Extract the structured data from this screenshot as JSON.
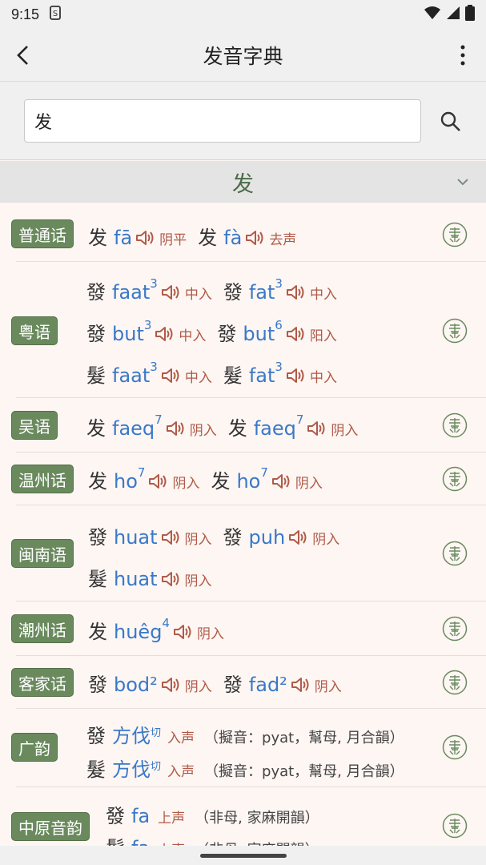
{
  "status": {
    "time": "9:15",
    "sim_icon": "sim-icon"
  },
  "app": {
    "title": "发音字典"
  },
  "search": {
    "value": "发",
    "placeholder": ""
  },
  "header": {
    "char": "发"
  },
  "rows": {
    "putonghua": {
      "label": "普通话",
      "l1": {
        "a_hz": "发",
        "a_py": "fā",
        "a_tone": "阴平",
        "b_hz": "发",
        "b_py": "fà",
        "b_tone": "去声"
      }
    },
    "yue": {
      "label": "粤语",
      "l1": {
        "a_hz": "發",
        "a_py": "faat",
        "a_n": "3",
        "a_tone": "中入",
        "b_hz": "發",
        "b_py": "fat",
        "b_n": "3",
        "b_tone": "中入"
      },
      "l2": {
        "a_hz": "發",
        "a_py": "but",
        "a_n": "3",
        "a_tone": "中入",
        "b_hz": "發",
        "b_py": "but",
        "b_n": "6",
        "b_tone": "阳入"
      },
      "l3": {
        "a_hz": "髮",
        "a_py": "faat",
        "a_n": "3",
        "a_tone": "中入",
        "b_hz": "髮",
        "b_py": "fat",
        "b_n": "3",
        "b_tone": "中入"
      }
    },
    "wu": {
      "label": "吴语",
      "l1": {
        "a_hz": "发",
        "a_py": "faeq",
        "a_n": "7",
        "a_tone": "阴入",
        "b_hz": "发",
        "b_py": "faeq",
        "b_n": "7",
        "b_tone": "阴入"
      }
    },
    "wenzhou": {
      "label": "温州话",
      "l1": {
        "a_hz": "发",
        "a_py": "ho",
        "a_n": "7",
        "a_tone": "阴入",
        "b_hz": "发",
        "b_py": "ho",
        "b_n": "7",
        "b_tone": "阴入"
      }
    },
    "minnan": {
      "label": "闽南语",
      "l1": {
        "a_hz": "發",
        "a_py": "huat",
        "a_tone": "阴入",
        "b_hz": "發",
        "b_py": "puh",
        "b_tone": "阴入"
      },
      "l2": {
        "a_hz": "髮",
        "a_py": "huat",
        "a_tone": "阴入"
      }
    },
    "chaozhou": {
      "label": "潮州话",
      "l1": {
        "a_hz": "发",
        "a_py": "huêg",
        "a_n": "4",
        "a_tone": "阴入"
      }
    },
    "hakka": {
      "label": "客家话",
      "l1": {
        "a_hz": "發",
        "a_py": "bod²",
        "a_tone": "阴入",
        "b_hz": "發",
        "b_py": "fad²",
        "b_tone": "阴入"
      }
    },
    "guangyun": {
      "label": "广韵",
      "l1": {
        "hz": "發",
        "py": "方伐",
        "qie": "切",
        "tone": "入声",
        "note": "（擬音：pyat，幫母, 月合韻）"
      },
      "l2": {
        "hz": "髮",
        "py": "方伐",
        "qie": "切",
        "tone": "入声",
        "note": "（擬音：pyat，幫母, 月合韻）"
      }
    },
    "zhongyuan": {
      "label": "中原音韵",
      "l1": {
        "hz": "發",
        "py": "fa",
        "tone": "上声",
        "note": "（非母, 家麻開韻）"
      },
      "l2": {
        "hz": "髮",
        "py": "fa",
        "tone": "上声",
        "note": "（非母, 家麻開韻）"
      }
    }
  },
  "colors": {
    "accent": "#6a8a5e",
    "pinyin": "#3a78c8",
    "tone": "#b05a48"
  }
}
